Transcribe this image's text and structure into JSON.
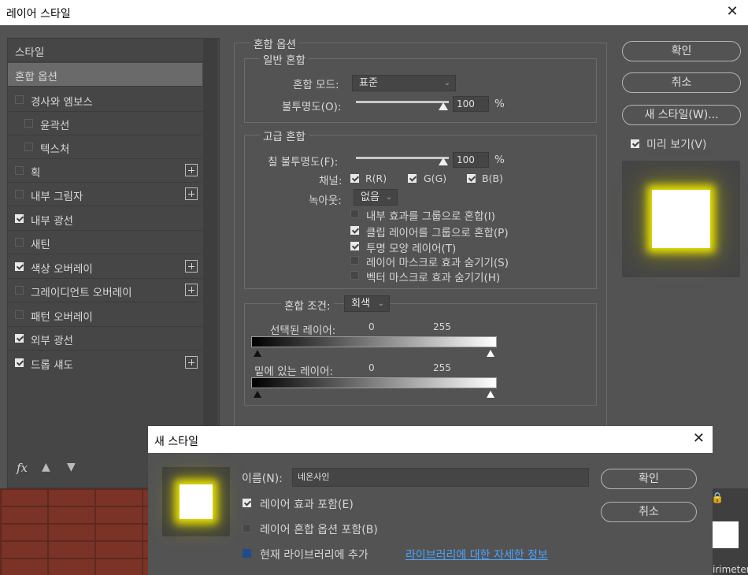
{
  "window": {
    "title": "레이어 스타일",
    "close": "✕"
  },
  "left_panel": {
    "items": [
      {
        "label": "스타일"
      },
      {
        "label": "혼합 옵션"
      },
      {
        "label": "경사와 엠보스"
      },
      {
        "label": "윤곽선"
      },
      {
        "label": "텍스처"
      },
      {
        "label": "획"
      },
      {
        "label": "내부 그림자"
      },
      {
        "label": "내부 광선"
      },
      {
        "label": "새틴"
      },
      {
        "label": "색상 오버레이"
      },
      {
        "label": "그레이디언트 오버레이"
      },
      {
        "label": "패턴 오버레이"
      },
      {
        "label": "외부 광선"
      },
      {
        "label": "드롭 섀도"
      }
    ],
    "fx_label": "fx"
  },
  "blending": {
    "legend": "혼합 옵션",
    "general": {
      "legend": "일반 혼합",
      "mode_label": "혼합 모드:",
      "mode_value": "표준",
      "opacity_label": "불투명도(O):",
      "opacity_value": "100",
      "percent": "%"
    },
    "advanced": {
      "legend": "고급 혼합",
      "fill_label": "칠 불투명도(F):",
      "fill_value": "100",
      "percent": "%",
      "channels_label": "채널:",
      "ch_r": "R(R)",
      "ch_g": "G(G)",
      "ch_b": "B(B)",
      "knockout_label": "녹아웃:",
      "knockout_value": "없음",
      "options": [
        {
          "label": "내부 효과를 그룹으로 혼합(I)"
        },
        {
          "label": "클립 레이어를 그룹으로 혼합(P)"
        },
        {
          "label": "투명 모양 레이어(T)"
        },
        {
          "label": "레이어 마스크로 효과 숨기기(S)"
        },
        {
          "label": "벡터 마스크로 효과 숨기기(H)"
        }
      ]
    },
    "blend_if": {
      "label": "혼합 조건:",
      "value": "회색",
      "this_layer": "선택된 레이어:",
      "underlying": "밑에 있는 레이어:",
      "min": "0",
      "max": "255"
    }
  },
  "right": {
    "ok": "확인",
    "cancel": "취소",
    "new_style": "새 스타일(W)...",
    "preview": "미리 보기(V)",
    "glow_color": "#e8e000"
  },
  "new_style_dialog": {
    "title": "새 스타일",
    "close": "✕",
    "name_label": "이름(N):",
    "name_value": "네온사인",
    "include_effects": "레이어 효과 포함(E)",
    "include_blending": "레이어 혼합 옵션 포함(B)",
    "add_library": "현재 라이브러리에 추가",
    "library_link": "라이브러리에 대한 자세한 정보",
    "ok": "확인",
    "cancel": "취소"
  },
  "background": {
    "partial_text": "irimeter"
  }
}
